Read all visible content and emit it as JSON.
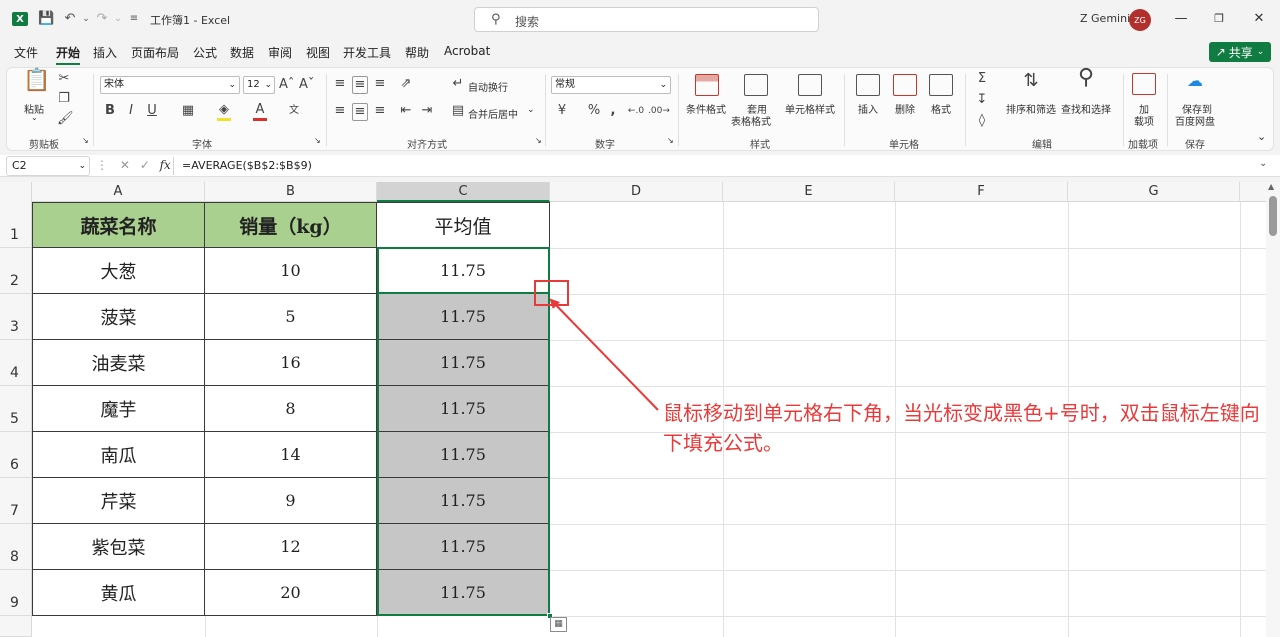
{
  "window": {
    "title": "工作簿1 - Excel",
    "search_placeholder": "搜索",
    "user_name": "Z Gemini",
    "user_initials": "ZG"
  },
  "menu": {
    "items": [
      "文件",
      "开始",
      "插入",
      "页面布局",
      "公式",
      "数据",
      "审阅",
      "视图",
      "开发工具",
      "帮助",
      "Acrobat"
    ],
    "active": "开始",
    "share_label": "共享"
  },
  "ribbon": {
    "clipboard": {
      "paste": "粘贴",
      "label": "剪贴板"
    },
    "font": {
      "name": "宋体",
      "size": "12",
      "label": "字体",
      "bold": "B",
      "italic": "I",
      "underline": "U"
    },
    "alignment": {
      "wrap": "自动换行",
      "merge": "合并后居中",
      "label": "对齐方式"
    },
    "number": {
      "format": "常规",
      "label": "数字",
      "percent": "%"
    },
    "styles": {
      "conditional": "条件格式",
      "table_line1": "套用",
      "table_line2": "表格格式",
      "cell_styles": "单元格样式",
      "label": "样式"
    },
    "cells": {
      "insert": "插入",
      "delete": "删除",
      "format": "格式",
      "label": "单元格"
    },
    "editing": {
      "sort_filter": "排序和筛选",
      "find_select": "查找和选择",
      "label": "编辑"
    },
    "addins": {
      "line1": "加",
      "line2": "载项",
      "label": "加载项"
    },
    "save": {
      "line1": "保存到",
      "line2": "百度网盘",
      "label": "保存"
    }
  },
  "formula_bar": {
    "name_box": "C2",
    "fx": "fx",
    "formula": "=AVERAGE($B$2:$B$9)"
  },
  "sheet": {
    "columns": [
      "A",
      "B",
      "C",
      "D",
      "E",
      "F",
      "G"
    ],
    "selected_column": "C",
    "rows": [
      "1",
      "2",
      "3",
      "4",
      "5",
      "6",
      "7",
      "8",
      "9"
    ],
    "headers": [
      "蔬菜名称",
      "销量（kg）",
      "平均值"
    ],
    "data": [
      {
        "name": "大葱",
        "sales": "10",
        "avg": "11.75"
      },
      {
        "name": "菠菜",
        "sales": "5",
        "avg": "11.75"
      },
      {
        "name": "油麦菜",
        "sales": "16",
        "avg": "11.75"
      },
      {
        "name": "魔芋",
        "sales": "8",
        "avg": "11.75"
      },
      {
        "name": "南瓜",
        "sales": "14",
        "avg": "11.75"
      },
      {
        "name": "芹菜",
        "sales": "9",
        "avg": "11.75"
      },
      {
        "name": "紫包菜",
        "sales": "12",
        "avg": "11.75"
      },
      {
        "name": "黄瓜",
        "sales": "20",
        "avg": "11.75"
      }
    ]
  },
  "annotation": {
    "text": "鼠标移动到单元格右下角，当光标变成黑色+号时，双击鼠标左键向下填充公式。",
    "color": "#e83a3a"
  },
  "colors": {
    "accent": "#107c41",
    "header_fill": "#a9d08e",
    "fill_selection": "#c6c6c6"
  }
}
